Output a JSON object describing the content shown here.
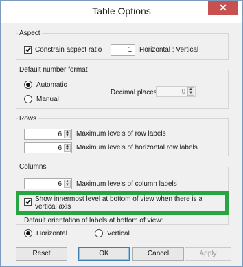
{
  "window": {
    "title": "Table Options",
    "close_glyph": "✕"
  },
  "aspect": {
    "legend": "Aspect",
    "constrain_label": "Constrain aspect ratio",
    "constrain_checked": true,
    "ratio_value": "1",
    "ratio_suffix": "Horizontal : Vertical"
  },
  "number_format": {
    "legend": "Default number format",
    "automatic_label": "Automatic",
    "manual_label": "Manual",
    "selected": "Automatic",
    "decimal_label": "Decimal places:",
    "decimal_value": "0"
  },
  "rows": {
    "legend": "Rows",
    "row_labels_value": "6",
    "row_labels_text": "Maximum levels of row labels",
    "horizontal_row_labels_value": "6",
    "horizontal_row_labels_text": "Maximum levels of horizontal row labels"
  },
  "columns": {
    "legend": "Columns",
    "column_labels_value": "6",
    "column_labels_text": "Maximum levels of column labels",
    "innermost_label_line1": "Show innermost level at bottom of view when there is a",
    "innermost_label_line2": "vertical axis",
    "innermost_checked": true
  },
  "orientation": {
    "label": "Default orientation of labels at bottom of view:",
    "horizontal_label": "Horizontal",
    "vertical_label": "Vertical",
    "selected": "Horizontal"
  },
  "buttons": {
    "reset": "Reset",
    "ok": "OK",
    "cancel": "Cancel",
    "apply": "Apply"
  },
  "colors": {
    "highlight": "#27a540",
    "close": "#c75050"
  },
  "icons": {
    "check": "check-icon",
    "spin": "spinner-arrows-icon",
    "close": "close-icon"
  }
}
